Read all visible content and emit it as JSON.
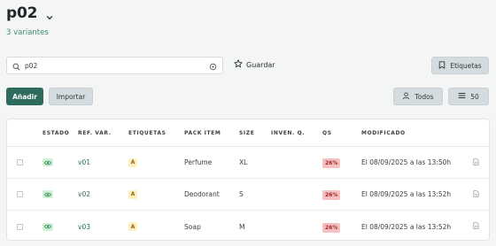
{
  "header": {
    "title": "p02",
    "subtitle": "3 variantes"
  },
  "search": {
    "value": "p02",
    "save_label": "Guardar"
  },
  "toolbar": {
    "etiquetas_label": "Etiquetas",
    "add_label": "Añadir",
    "import_label": "Importar",
    "all_label": "Todos",
    "page_size_label": "50"
  },
  "table": {
    "columns": {
      "estado": "ESTADO",
      "ref": "REF. VAR.",
      "etiquetas": "ETIQUETAS",
      "pack": "PACK ITEM",
      "size": "SIZE",
      "inven": "INVEN. Q.",
      "qs": "QS",
      "modificado": "MODIFICADO"
    },
    "rows": [
      {
        "ref": "v01",
        "tag": "A",
        "pack": "Perfume",
        "size": "XL",
        "qs": "26%",
        "modified": "El 08/09/2025 a las 13:50h"
      },
      {
        "ref": "v02",
        "tag": "A",
        "pack": "Deodorant",
        "size": "S",
        "qs": "26%",
        "modified": "El 08/09/2025 a las 13:52h"
      },
      {
        "ref": "v03",
        "tag": "A",
        "pack": "Soap",
        "size": "M",
        "qs": "26%",
        "modified": "El 08/09/2025 a las 13:52h"
      }
    ]
  },
  "colors": {
    "accent": "#2e6b5c",
    "status_ok": "#d2f0d8",
    "qs_bad": "#f5c0c0",
    "tag": "#fdefc0"
  },
  "icons": [
    "chevron-down-icon",
    "search-icon",
    "clear-icon",
    "star-icon",
    "bookmark-icon",
    "user-icon",
    "list-icon",
    "eye-icon",
    "document-icon"
  ]
}
